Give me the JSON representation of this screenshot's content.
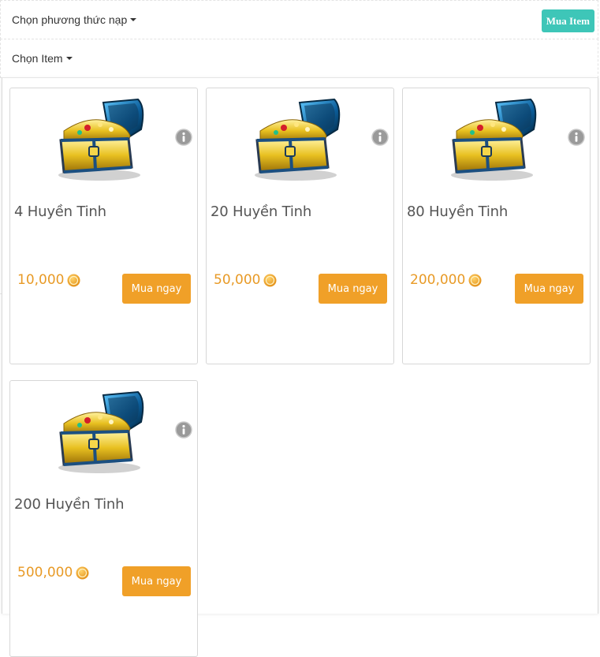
{
  "header": {
    "payment_method_label": "Chọn phương thức nạp",
    "buy_item_button": "Mua Item"
  },
  "subheader": {
    "item_select_label": "Chọn Item"
  },
  "products": [
    {
      "name": "4 Huyền Tinh",
      "price": "10,000",
      "buy_label": "Mua ngay"
    },
    {
      "name": "20 Huyền Tinh",
      "price": "50,000",
      "buy_label": "Mua ngay"
    },
    {
      "name": "80 Huyền Tinh",
      "price": "200,000",
      "buy_label": "Mua ngay"
    },
    {
      "name": "200 Huyền Tinh",
      "price": "500,000",
      "buy_label": "Mua ngay"
    }
  ],
  "colors": {
    "accent_teal": "#3ec6b8",
    "buy_orange": "#f0a028",
    "price_orange": "#e89a26"
  },
  "icons": {
    "product_image": "treasure-chest-icon",
    "info": "info-icon",
    "coin": "coin-icon",
    "dropdown": "caret-down-icon"
  }
}
